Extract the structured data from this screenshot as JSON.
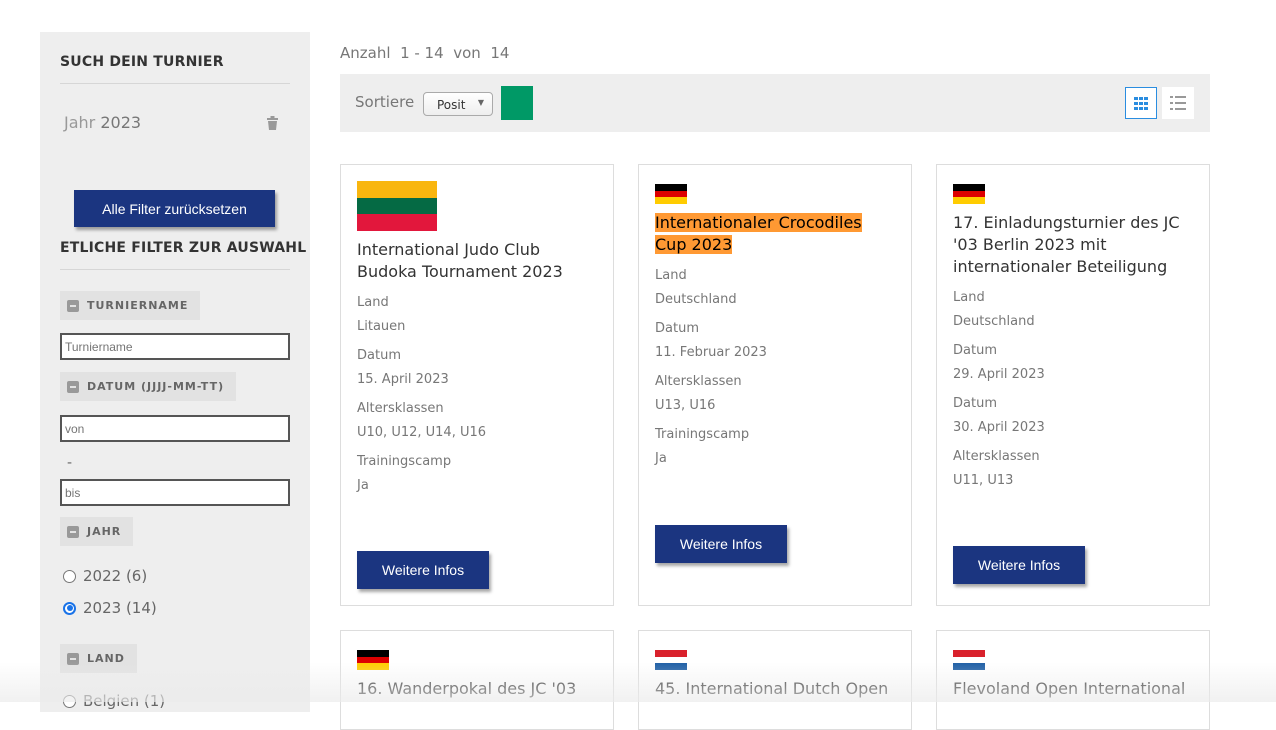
{
  "sidebar": {
    "title": "SUCH DEIN TURNIER",
    "active_filter_label": "Jahr",
    "active_filter_value": "2023",
    "reset_label": "Alle Filter zurücksetzen",
    "filters_heading": "ETLICHE FILTER ZUR AUSWAHL",
    "group_name": "TURNIERNAME",
    "name_placeholder": "Turniername",
    "group_date": "DATUM (JJJJ-MM-TT)",
    "date_from_placeholder": "von",
    "date_sep": "-",
    "date_to_placeholder": "bis",
    "group_year": "JAHR",
    "years": [
      {
        "label": "2022 (6)",
        "checked": false
      },
      {
        "label": "2023 (14)",
        "checked": true
      }
    ],
    "group_country": "LAND",
    "countries": [
      {
        "label": "Belgien (1)"
      }
    ]
  },
  "header": {
    "count_label": "Anzahl",
    "range": "1 - 14",
    "of": "von",
    "total": "14",
    "sort_label": "Sortiere",
    "sort_value": "Posit",
    "accent": "#009966"
  },
  "cards": [
    {
      "title": "International Judo Club Budoka Tournament 2023",
      "flag": "lithuania",
      "fields": [
        [
          "Land",
          "Litauen"
        ],
        [
          "Datum",
          "15. April 2023"
        ],
        [
          "Altersklassen",
          "U10, U12, U14, U16"
        ],
        [
          "Trainingscamp",
          "Ja"
        ]
      ],
      "button": "Weitere Infos"
    },
    {
      "title": "Internationaler Crocodiles Cup 2023",
      "flag": "germany",
      "highlight": true,
      "fields": [
        [
          "Land",
          "Deutschland"
        ],
        [
          "Datum",
          "11. Februar 2023"
        ],
        [
          "Altersklassen",
          "U13, U16"
        ],
        [
          "Trainingscamp",
          "Ja"
        ]
      ],
      "button": "Weitere Infos"
    },
    {
      "title": "17. Einladungsturnier des JC '03 Berlin 2023 mit internationaler Beteiligung",
      "flag": "germany",
      "fields": [
        [
          "Land",
          "Deutschland"
        ],
        [
          "Datum",
          "29. April 2023"
        ],
        [
          "Datum",
          "30. April 2023"
        ],
        [
          "Altersklassen",
          "U11, U13"
        ]
      ],
      "button": "Weitere Infos"
    },
    {
      "title": "16. Wanderpokal des JC '03",
      "flag": "germany"
    },
    {
      "title": "45. International Dutch Open",
      "flag": "netherlands"
    },
    {
      "title": "Flevoland Open International",
      "flag": "netherlands"
    }
  ]
}
